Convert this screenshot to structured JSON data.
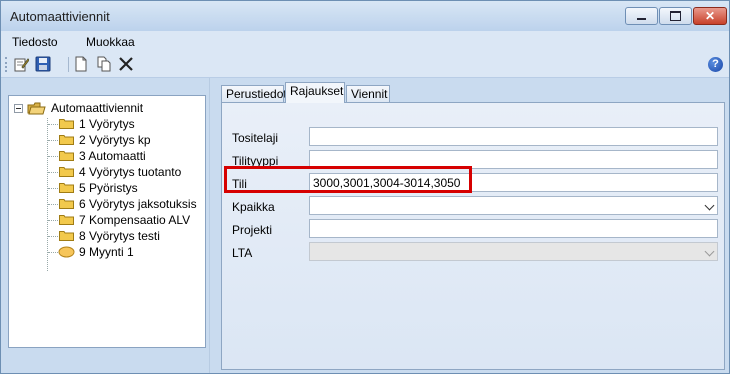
{
  "window": {
    "title": "Automaattiviennit"
  },
  "menu": {
    "items": [
      "Tiedosto",
      "Muokkaa"
    ]
  },
  "toolbar": {
    "icons": [
      "edit-icon",
      "save-icon",
      "new-document-icon",
      "copy-icon",
      "delete-icon"
    ],
    "help_label": "?"
  },
  "tree": {
    "root": "Automaattiviennit",
    "items": [
      "1 Vyörytys",
      "2 Vyörytys kp",
      "3 Automaatti",
      "4 Vyörytys tuotanto",
      "5 Pyöristys",
      "6 Vyörytys jaksotuksis",
      "7 Kompensaatio ALV",
      "8 Vyörytys testi",
      "9 Myynti 1"
    ]
  },
  "tabs": [
    "Perustiedot",
    "Rajaukset",
    "Viennit"
  ],
  "active_tab": "Rajaukset",
  "form": {
    "tositelaji": {
      "label": "Tositelaji",
      "value": ""
    },
    "tilityyppi": {
      "label": "Tilityyppi",
      "value": ""
    },
    "tili": {
      "label": "Tili",
      "value": "3000,3001,3004-3014,3050"
    },
    "kpaikka": {
      "label": "Kpaikka",
      "value": ""
    },
    "projekti": {
      "label": "Projekti",
      "value": ""
    },
    "lta": {
      "label": "LTA",
      "value": ""
    }
  },
  "colors": {
    "highlight": "#d60000",
    "background": "#c9dbef",
    "close_button": "#c8412b"
  }
}
